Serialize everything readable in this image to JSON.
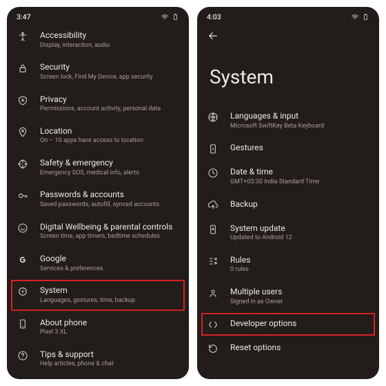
{
  "left": {
    "time": "3:47",
    "items": [
      {
        "icon": "accessibility",
        "title": "Accessibility",
        "sub": "Display, interaction, audio"
      },
      {
        "icon": "lock",
        "title": "Security",
        "sub": "Screen lock, Find My Device, app security"
      },
      {
        "icon": "privacy",
        "title": "Privacy",
        "sub": "Permissions, account activity, personal data"
      },
      {
        "icon": "location",
        "title": "Location",
        "sub": "On – 10 apps have access to location"
      },
      {
        "icon": "emergency",
        "title": "Safety & emergency",
        "sub": "Emergency SOS, medical info, alerts"
      },
      {
        "icon": "passwords",
        "title": "Passwords & accounts",
        "sub": "Saved passwords, autofill, synced accounts"
      },
      {
        "icon": "wellbeing",
        "title": "Digital Wellbeing & parental controls",
        "sub": "Screen time, app timers, bedtime schedules"
      },
      {
        "icon": "google",
        "title": "Google",
        "sub": "Services & preferences"
      },
      {
        "icon": "system",
        "title": "System",
        "sub": "Languages, gestures, time, backup",
        "highlight": true
      },
      {
        "icon": "about",
        "title": "About phone",
        "sub": "Pixel 3 XL"
      },
      {
        "icon": "support",
        "title": "Tips & support",
        "sub": "Help articles, phone & chat"
      }
    ]
  },
  "right": {
    "time": "4:03",
    "page_title": "System",
    "items": [
      {
        "icon": "language",
        "title": "Languages & input",
        "sub": "Microsoft SwiftKey Beta Keyboard"
      },
      {
        "icon": "gestures",
        "title": "Gestures",
        "sub": ""
      },
      {
        "icon": "clock",
        "title": "Date & time",
        "sub": "GMT+05:30 India Standard Time"
      },
      {
        "icon": "backup",
        "title": "Backup",
        "sub": ""
      },
      {
        "icon": "update",
        "title": "System update",
        "sub": "Updated to Android 12"
      },
      {
        "icon": "rules",
        "title": "Rules",
        "sub": "0 rules"
      },
      {
        "icon": "users",
        "title": "Multiple users",
        "sub": "Signed in as Owner"
      },
      {
        "icon": "dev",
        "title": "Developer options",
        "sub": "",
        "highlight": true
      },
      {
        "icon": "reset",
        "title": "Reset options",
        "sub": ""
      }
    ]
  }
}
